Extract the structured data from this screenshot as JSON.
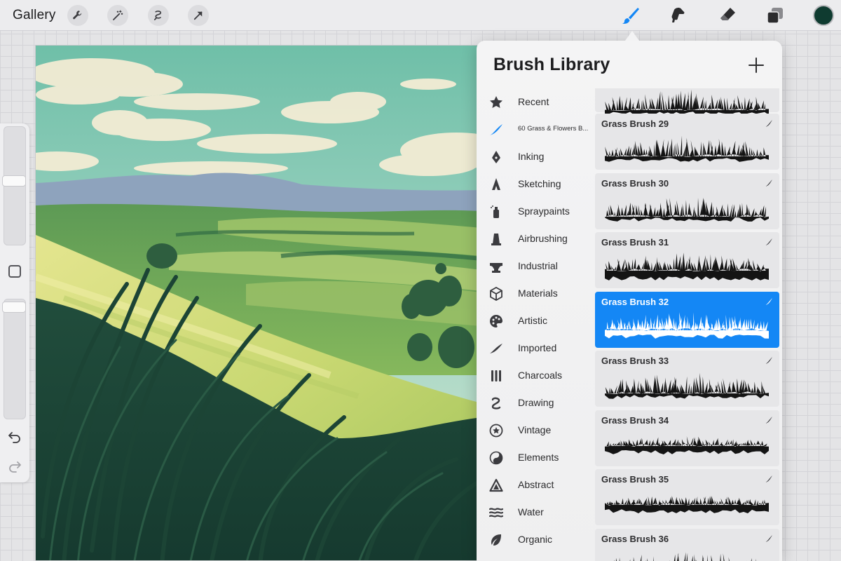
{
  "toolbar": {
    "gallery_label": "Gallery",
    "left_tools": [
      "wrench-icon",
      "magic-wand-icon",
      "selection-icon",
      "transform-arrow-icon"
    ],
    "right_tools": [
      "brush-icon",
      "smudge-icon",
      "eraser-icon",
      "layers-icon"
    ],
    "active_tool": "brush-icon",
    "active_color": "#0f3b30",
    "accent_color": "#1487f5"
  },
  "sidebar": {
    "controls": [
      "brush-size-slider",
      "modify-button",
      "opacity-slider",
      "undo-icon",
      "redo-icon"
    ]
  },
  "panel": {
    "title": "Brush Library",
    "sets": [
      {
        "label": "Recent",
        "icon": "star-icon"
      },
      {
        "label": "60 Grass & Flowers B...",
        "icon": "brush-stroke-icon",
        "active": true
      },
      {
        "label": "Inking",
        "icon": "pen-nib-icon"
      },
      {
        "label": "Sketching",
        "icon": "pencil-tip-icon"
      },
      {
        "label": "Spraypaints",
        "icon": "spray-can-icon"
      },
      {
        "label": "Airbrushing",
        "icon": "airbrush-icon"
      },
      {
        "label": "Industrial",
        "icon": "anvil-icon"
      },
      {
        "label": "Materials",
        "icon": "cube-icon"
      },
      {
        "label": "Artistic",
        "icon": "palette-icon"
      },
      {
        "label": "Imported",
        "icon": "swoosh-icon"
      },
      {
        "label": "Charcoals",
        "icon": "charcoal-sticks-icon"
      },
      {
        "label": "Drawing",
        "icon": "squiggle-icon"
      },
      {
        "label": "Vintage",
        "icon": "star-badge-icon"
      },
      {
        "label": "Elements",
        "icon": "yin-yang-icon"
      },
      {
        "label": "Abstract",
        "icon": "triangle-icon"
      },
      {
        "label": "Water",
        "icon": "waves-icon"
      },
      {
        "label": "Organic",
        "icon": "leaf-icon"
      }
    ],
    "brushes": [
      {
        "name": "",
        "style": "top-partial"
      },
      {
        "name": "Grass Brush 29",
        "style": "tall"
      },
      {
        "name": "Grass Brush 30",
        "style": "tufts"
      },
      {
        "name": "Grass Brush 31",
        "style": "dense"
      },
      {
        "name": "Grass Brush 32",
        "style": "fine",
        "selected": true
      },
      {
        "name": "Grass Brush 33",
        "style": "tall"
      },
      {
        "name": "Grass Brush 34",
        "style": "short"
      },
      {
        "name": "Grass Brush 35",
        "style": "short"
      },
      {
        "name": "Grass Brush 36",
        "style": "tall"
      }
    ]
  }
}
